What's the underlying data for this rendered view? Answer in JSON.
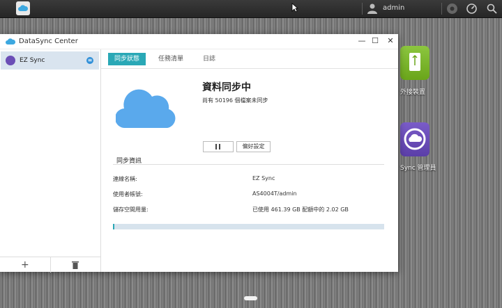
{
  "taskbar": {
    "app_icon": "datasync-center-icon",
    "user_label": "admin",
    "icons": [
      "user-icon",
      "notification-icon",
      "system-monitor-icon",
      "search-icon"
    ]
  },
  "window": {
    "title": "DataSync Center",
    "controls": [
      "minimize",
      "maximize",
      "close"
    ],
    "control_glyphs": {
      "minimize": "—",
      "maximize": "☐",
      "close": "✕"
    }
  },
  "sidebar": {
    "items": [
      {
        "label": "EZ Sync",
        "icon": "ez-sync-icon",
        "badge": "≡"
      }
    ],
    "footer": {
      "add_label": "+",
      "delete_icon": "trash-icon"
    }
  },
  "tabs": [
    {
      "label": "同步狀態",
      "active": true
    },
    {
      "label": "任務清單",
      "active": false
    },
    {
      "label": "日誌",
      "active": false
    }
  ],
  "status": {
    "title": "資料同步中",
    "subtitle": "尚有 50196 個檔案未同步",
    "preferences_label": "偏好設定"
  },
  "sync_info": {
    "section_title": "同步資訊",
    "rows": [
      {
        "label": "連線名稱:",
        "value": "EZ Sync"
      },
      {
        "label": "使用者帳號:",
        "value": "AS4004T/admin"
      },
      {
        "label": "儲存空間用量:",
        "value": "已使用 461.39 GB 配額中的 2.02 GB"
      }
    ],
    "progress_fraction": 0.005
  },
  "desktop": {
    "icons": [
      {
        "label": "外接裝置",
        "icon": "external-devices-icon",
        "color": "#7cb518"
      },
      {
        "label": "Sync 管理員",
        "icon": "ez-sync-manager-icon",
        "color": "#6b4eb6"
      }
    ]
  },
  "colors": {
    "accent": "#2aa8b6",
    "cloud": "#5aa9ec",
    "selected_bg": "#d9e4ef"
  }
}
